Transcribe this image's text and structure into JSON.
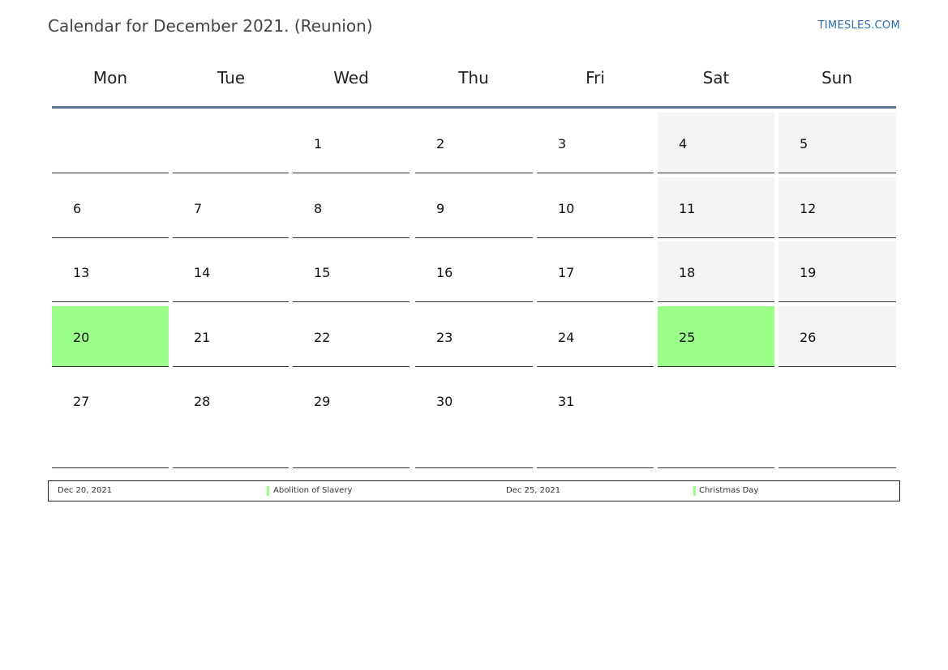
{
  "header": {
    "title": "Calendar for December 2021. (Reunion)",
    "site": "TIMESLES.COM"
  },
  "weekdays": [
    "Mon",
    "Tue",
    "Wed",
    "Thu",
    "Fri",
    "Sat",
    "Sun"
  ],
  "weeks": [
    [
      null,
      null,
      1,
      2,
      3,
      4,
      5
    ],
    [
      6,
      7,
      8,
      9,
      10,
      11,
      12
    ],
    [
      13,
      14,
      15,
      16,
      17,
      18,
      19
    ],
    [
      20,
      21,
      22,
      23,
      24,
      25,
      26
    ],
    [
      27,
      28,
      29,
      30,
      31,
      null,
      null
    ]
  ],
  "holiday_days": [
    20,
    25
  ],
  "colors": {
    "holiday": "#99ff88",
    "weekend": "#f4f4f4",
    "header_rule": "#5d7393",
    "link": "#2b6cb0"
  },
  "legend": [
    {
      "date": "Dec 20, 2021",
      "name": "Abolition of Slavery",
      "color": "#99ff88"
    },
    {
      "date": "Dec 25, 2021",
      "name": "Christmas Day",
      "color": "#99ff88"
    }
  ]
}
